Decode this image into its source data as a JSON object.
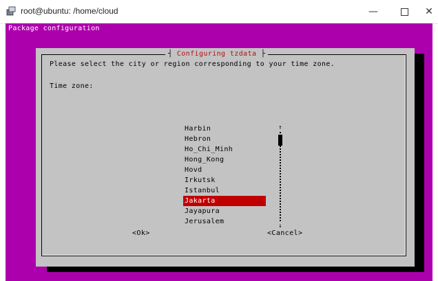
{
  "window": {
    "title": "root@ubuntu: /home/cloud",
    "icons": {
      "app": "putty-icon",
      "minimize": "minimize-icon",
      "maximize": "maximize-icon",
      "close": "close-icon"
    }
  },
  "terminal": {
    "header": "Package configuration",
    "background_color": "#ad00ad"
  },
  "dialog": {
    "title": "Configuring tzdata",
    "prompt": "Please select the city or region corresponding to your time zone.",
    "time_zone_label": "Time zone:",
    "options": [
      "Harbin",
      "Hebron",
      "Ho_Chi_Minh",
      "Hong_Kong",
      "Hovd",
      "Irkutsk",
      "Istanbul",
      "Jakarta",
      "Jayapura",
      "Jerusalem"
    ],
    "selected_option": "Jakarta",
    "selected_color": "#c00000",
    "scroll_up_arrow": "↑",
    "scroll_down_arrow": "↓",
    "ok_button": "<Ok>",
    "cancel_button": "<Cancel>"
  }
}
